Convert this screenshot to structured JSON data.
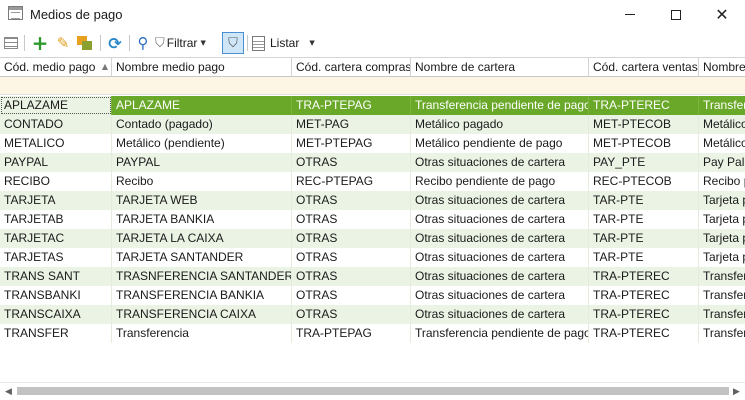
{
  "window": {
    "title": "Medios de pago"
  },
  "toolbar": {
    "filter_label": "Filtrar",
    "list_label": "Listar"
  },
  "columns": [
    "Cód. medio pago",
    "Nombre medio pago",
    "Cód. cartera compras",
    "Nombre de cartera",
    "Cód. cartera ventas",
    "Nombre"
  ],
  "sort": {
    "column": "Cód. medio pago",
    "direction": "ascending"
  },
  "selected_row": 0,
  "rows": [
    [
      "APLAZAME",
      "APLAZAME",
      "TRA-PTEPAG",
      "Transferencia pendiente de pago",
      "TRA-PTEREC",
      "Transfer"
    ],
    [
      "CONTADO",
      "Contado (pagado)",
      "MET-PAG",
      "Metálico pagado",
      "MET-PTECOB",
      "Metálico"
    ],
    [
      "METALICO",
      "Metálico (pendiente)",
      "MET-PTEPAG",
      "Metálico pendiente de pago",
      "MET-PTECOB",
      "Metálico"
    ],
    [
      "PAYPAL",
      "PAYPAL",
      "OTRAS",
      "Otras situaciones de cartera",
      "PAY_PTE",
      "Pay Pal p"
    ],
    [
      "RECIBO",
      "Recibo",
      "REC-PTEPAG",
      "Recibo pendiente de pago",
      "REC-PTECOB",
      "Recibo p"
    ],
    [
      "TARJETA",
      "TARJETA WEB",
      "OTRAS",
      "Otras situaciones de cartera",
      "TAR-PTE",
      "Tarjeta p"
    ],
    [
      "TARJETAB",
      "TARJETA BANKIA",
      "OTRAS",
      "Otras situaciones de cartera",
      "TAR-PTE",
      "Tarjeta p"
    ],
    [
      "TARJETAC",
      "TARJETA LA CAIXA",
      "OTRAS",
      "Otras situaciones de cartera",
      "TAR-PTE",
      "Tarjeta p"
    ],
    [
      "TARJETAS",
      "TARJETA SANTANDER",
      "OTRAS",
      "Otras situaciones de cartera",
      "TAR-PTE",
      "Tarjeta p"
    ],
    [
      "TRANS SANT",
      "TRASNFERENCIA SANTANDER",
      "OTRAS",
      "Otras situaciones de cartera",
      "TRA-PTEREC",
      "Transfer"
    ],
    [
      "TRANSBANKI",
      "TRANSFERENCIA BANKIA",
      "OTRAS",
      "Otras situaciones de cartera",
      "TRA-PTEREC",
      "Transfer"
    ],
    [
      "TRANSCAIXA",
      "TRANSFERENCIA CAIXA",
      "OTRAS",
      "Otras situaciones de cartera",
      "TRA-PTEREC",
      "Transfer"
    ],
    [
      "TRANSFER",
      "Transferencia",
      "TRA-PTEPAG",
      "Transferencia pendiente de pago",
      "TRA-PTEREC",
      "Transfer"
    ]
  ],
  "colors": {
    "selected_row": "#6aa829",
    "alt_row": "#eaf3e4",
    "filter_row": "#fef6e4"
  },
  "icons": {
    "window": "window-icon",
    "list_view": "list-view-icon",
    "add": "add-icon",
    "edit": "edit-icon",
    "copy": "copy-icon",
    "refresh": "refresh-icon",
    "search": "search-icon",
    "filter": "filter-icon",
    "quick_filter": "quick-filter-icon",
    "print": "print-icon"
  }
}
